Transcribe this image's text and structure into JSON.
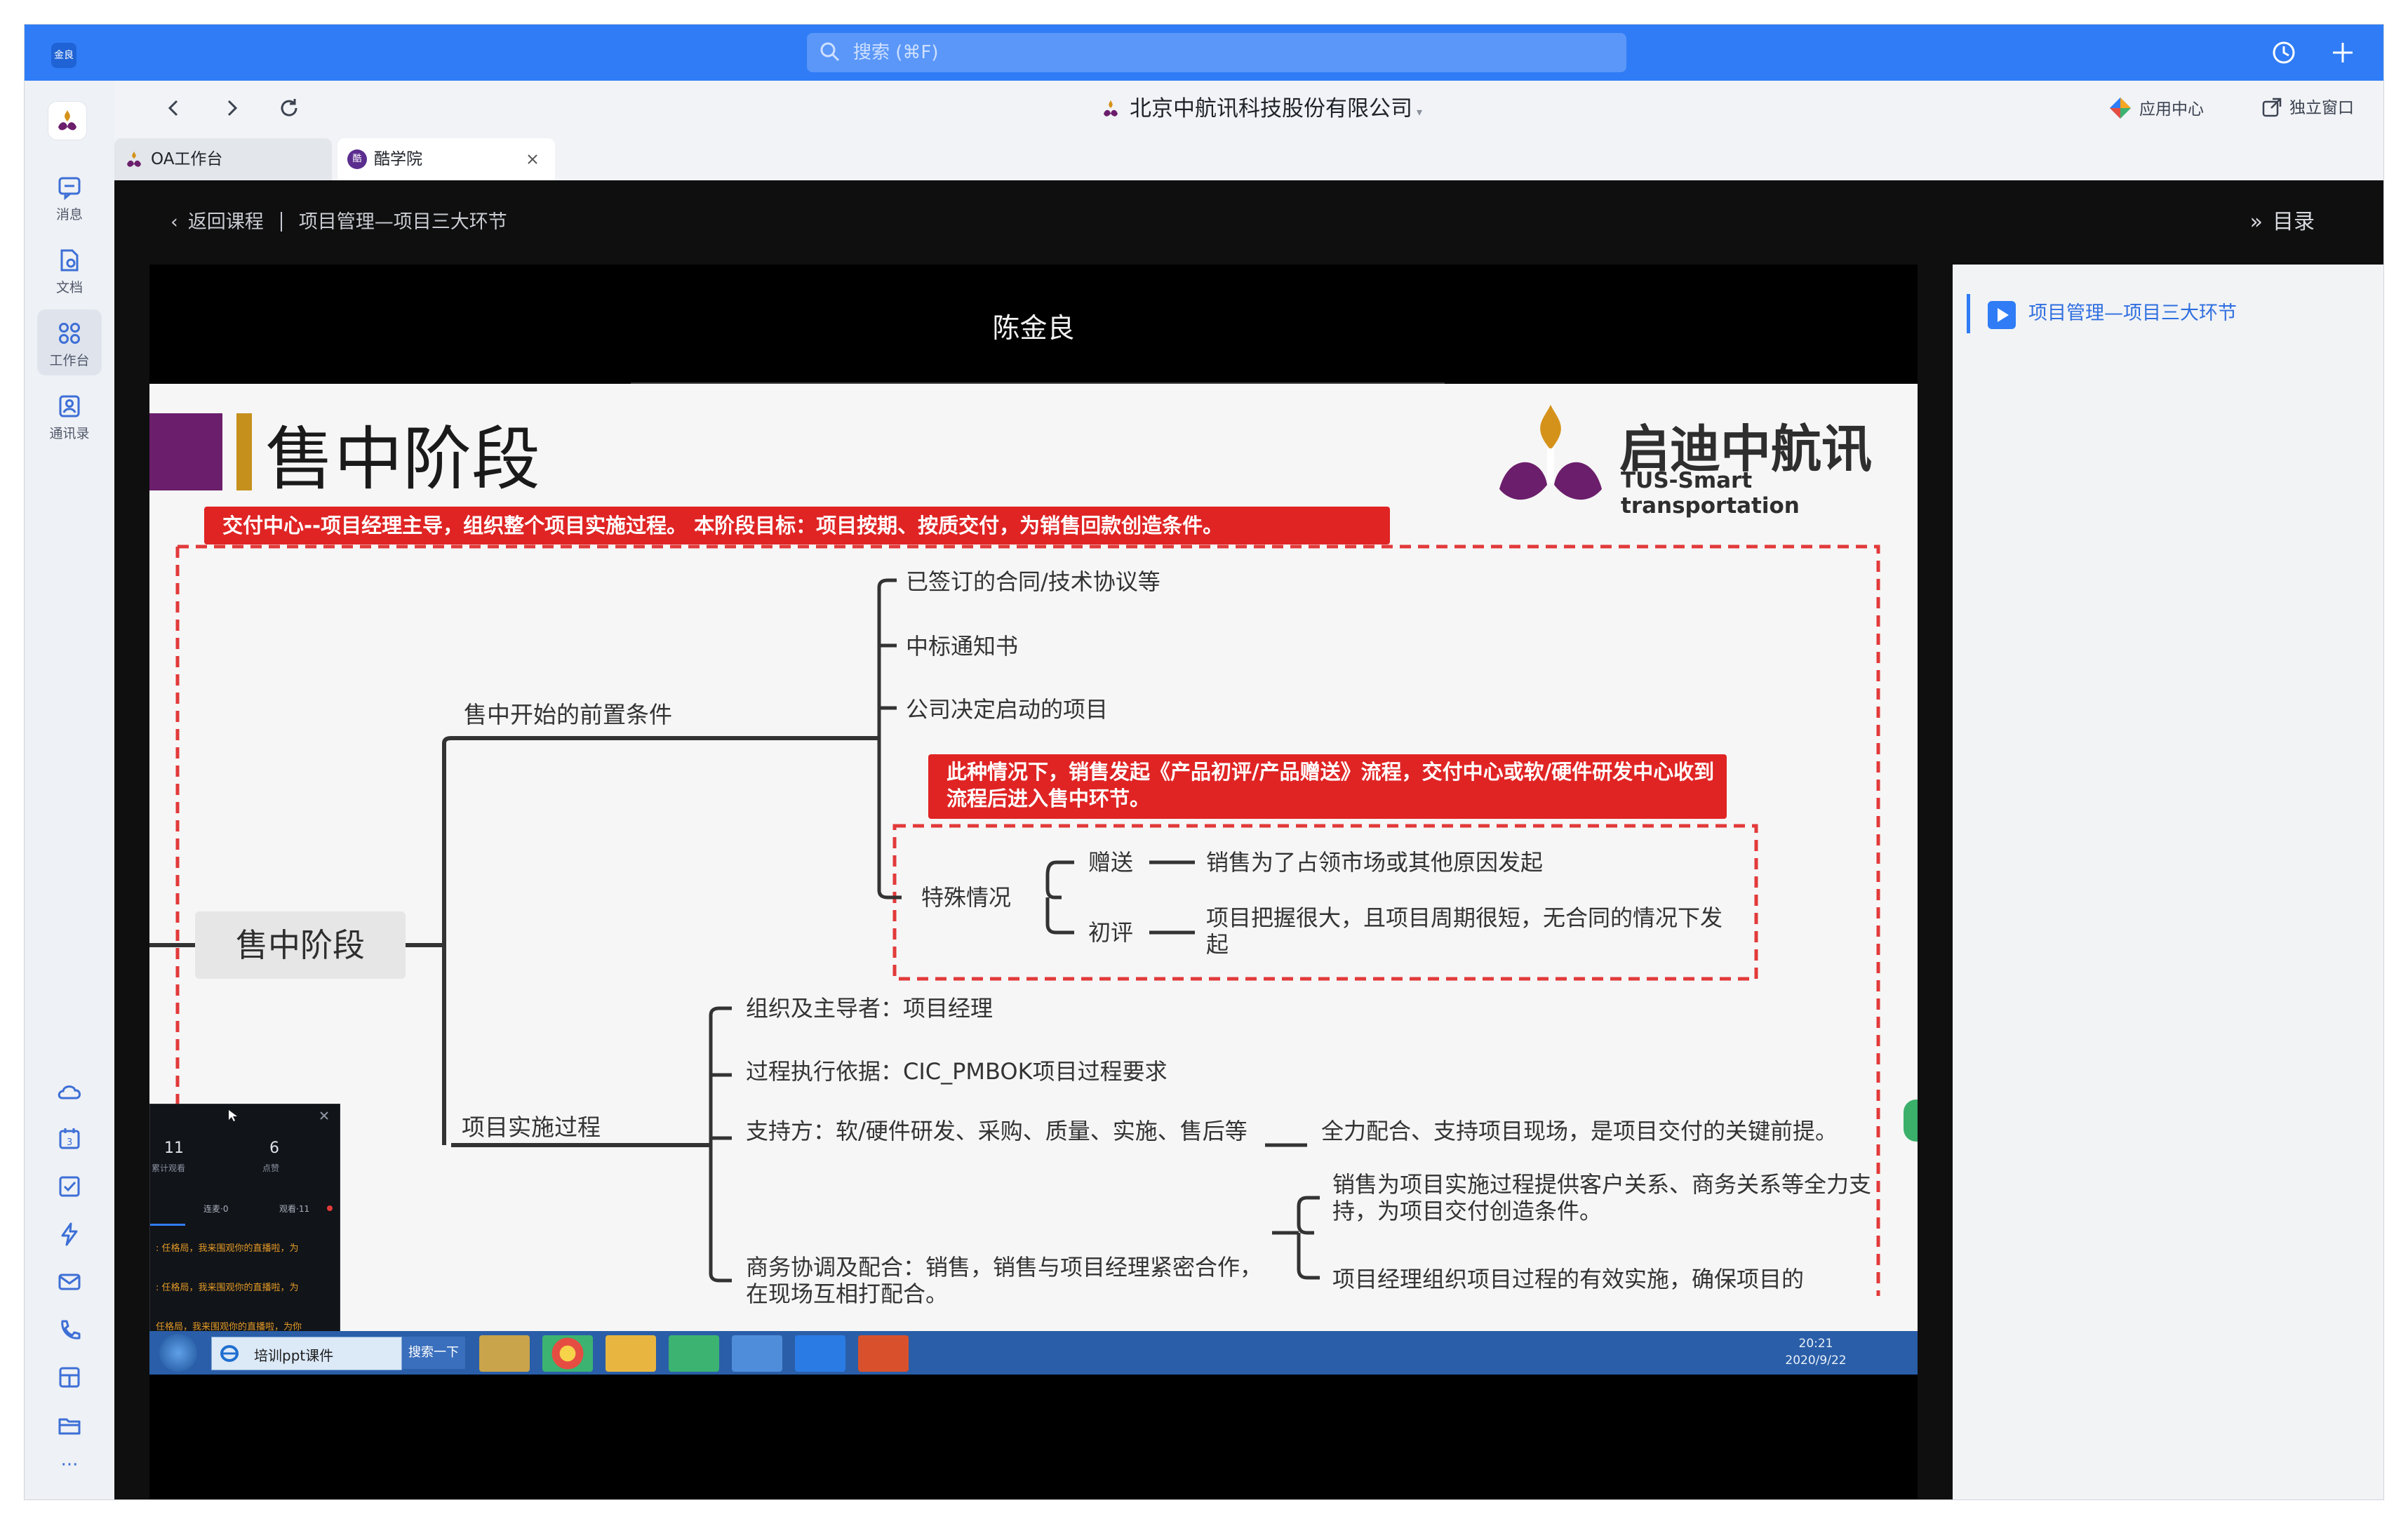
{
  "titlebar": {
    "brand": "金良",
    "search_placeholder": "搜索 (⌘F)",
    "accent": "#2f7cf6"
  },
  "sidebar": {
    "items": [
      {
        "label": "消息",
        "icon": "message-icon"
      },
      {
        "label": "文档",
        "icon": "document-icon"
      },
      {
        "label": "工作台",
        "icon": "workbench-icon"
      },
      {
        "label": "通讯录",
        "icon": "contacts-icon"
      }
    ],
    "active_item": "工作台",
    "more": "···"
  },
  "navbar": {
    "company": "北京中航讯科技股份有限公司",
    "app_center": "应用中心",
    "standalone": "独立窗口"
  },
  "tabs": [
    {
      "label": "OA工作台",
      "active": false
    },
    {
      "label": "酷学院",
      "active": true
    }
  ],
  "course": {
    "back": "返回课程",
    "title": "项目管理—项目三大环节",
    "toc": "目录"
  },
  "video": {
    "presenter": "陈金良",
    "slide": {
      "title": "售中阶段",
      "brand_cn": "启迪中航讯",
      "brand_en": "TUS-Smart transportation",
      "banner": "交付中心--项目经理主导，组织整个项目实施过程。  本阶段目标：项目按期、按质交付，为销售回款创造条件。",
      "root": "售中阶段",
      "pre_branch": "售中开始的前置条件",
      "pre_items": [
        "已签订的合同/技术协议等",
        "中标通知书",
        "公司决定启动的项目"
      ],
      "special_note": "此种情况下，销售发起《产品初评/产品赠送》流程，交付中心或软/硬件研发中心收到流程后进入售中环节。",
      "special_branch": "特殊情况",
      "special_items": [
        {
          "label": "赠送",
          "desc": "销售为了占领市场或其他原因发起"
        },
        {
          "label": "初评",
          "desc": "项目把握很大，且项目周期很短，无合同的情况下发起"
        }
      ],
      "impl_branch": "项目实施过程",
      "impl_items": [
        "组织及主导者：项目经理",
        "过程执行依据：CIC_PMBOK项目过程要求",
        "支持方：软/硬件研发、采购、质量、实施、售后等",
        "商务协调及配合：销售，销售与项目经理紧密合作，在现场互相打配合。"
      ],
      "support_desc": "全力配合、支持项目现场，是项目交付的关键前提。",
      "biz_descs": [
        "销售为项目实施过程提供客户关系、商务关系等全力支持，为项目交付创造条件。",
        "项目经理组织项目过程的有效实施，确保项目的"
      ]
    },
    "overlay": {
      "stats": [
        {
          "value": "11",
          "label": "累计观看"
        },
        {
          "value": "6",
          "label": "点赞"
        }
      ],
      "tabs": [
        "连麦·0",
        "观看·11"
      ],
      "messages": [
        ": 任格局，我来围观你的直播啦，为",
        ": 任格局，我来围观你的直播啦，为",
        "任格局，我来围观你的直播啦，为你"
      ]
    },
    "taskbar": {
      "search_text": "培训ppt课件",
      "search_button": "搜索一下",
      "time": "20:21",
      "date": "2020/9/22"
    }
  },
  "toc_items": [
    "项目管理—项目三大环节"
  ]
}
